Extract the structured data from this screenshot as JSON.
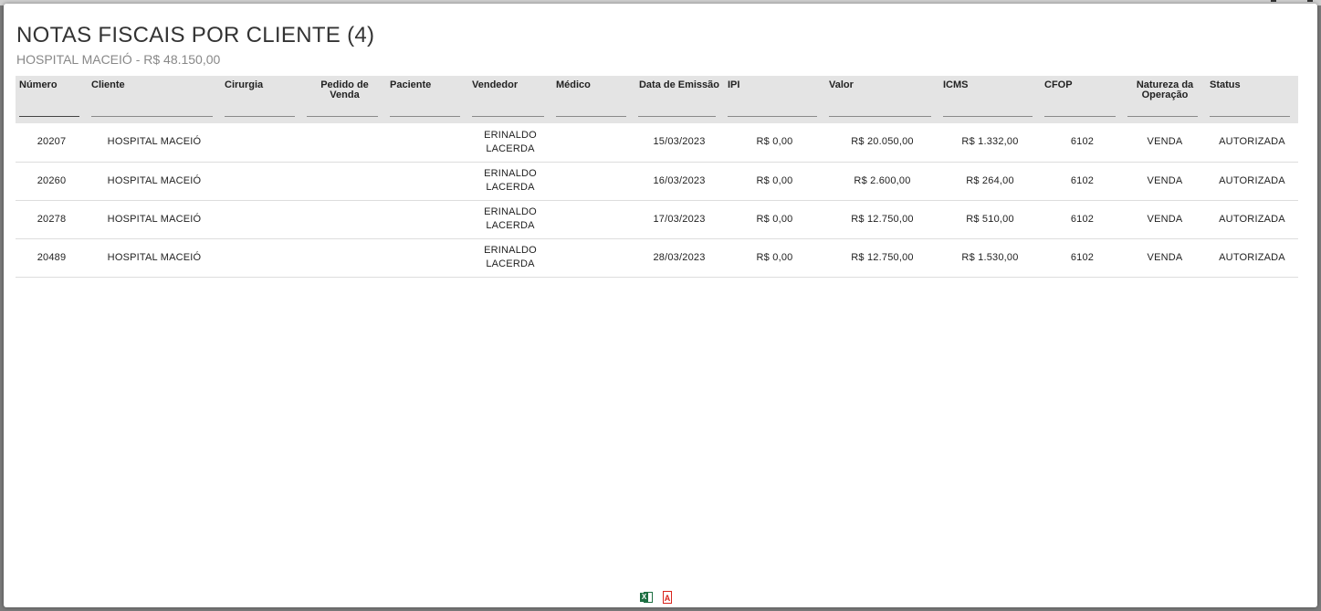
{
  "modal": {
    "title": "NOTAS FISCAIS POR CLIENTE (4)",
    "subtitle": "HOSPITAL MACEIÓ - R$ 48.150,00"
  },
  "table": {
    "columns": [
      {
        "key": "numero",
        "label": "Número"
      },
      {
        "key": "cliente",
        "label": "Cliente"
      },
      {
        "key": "cirurgia",
        "label": "Cirurgia"
      },
      {
        "key": "pedido",
        "label": "Pedido de Venda"
      },
      {
        "key": "paciente",
        "label": "Paciente"
      },
      {
        "key": "vendedor",
        "label": "Vendedor"
      },
      {
        "key": "medico",
        "label": "Médico"
      },
      {
        "key": "data",
        "label": "Data de Emissão"
      },
      {
        "key": "ipi",
        "label": "IPI"
      },
      {
        "key": "valor",
        "label": "Valor"
      },
      {
        "key": "icms",
        "label": "ICMS"
      },
      {
        "key": "cfop",
        "label": "CFOP"
      },
      {
        "key": "natureza",
        "label": "Natureza da Operação"
      },
      {
        "key": "status",
        "label": "Status"
      }
    ],
    "rows": [
      {
        "numero": "20207",
        "cliente": "HOSPITAL MACEIÓ",
        "cirurgia": "",
        "pedido": "",
        "paciente": "",
        "vendedor": "ERINALDO LACERDA",
        "medico": "",
        "data": "15/03/2023",
        "ipi": "R$ 0,00",
        "valor": "R$ 20.050,00",
        "icms": "R$ 1.332,00",
        "cfop": "6102",
        "natureza": "VENDA",
        "status": "AUTORIZADA"
      },
      {
        "numero": "20260",
        "cliente": "HOSPITAL MACEIÓ",
        "cirurgia": "",
        "pedido": "",
        "paciente": "",
        "vendedor": "ERINALDO LACERDA",
        "medico": "",
        "data": "16/03/2023",
        "ipi": "R$ 0,00",
        "valor": "R$ 2.600,00",
        "icms": "R$ 264,00",
        "cfop": "6102",
        "natureza": "VENDA",
        "status": "AUTORIZADA"
      },
      {
        "numero": "20278",
        "cliente": "HOSPITAL MACEIÓ",
        "cirurgia": "",
        "pedido": "",
        "paciente": "",
        "vendedor": "ERINALDO LACERDA",
        "medico": "",
        "data": "17/03/2023",
        "ipi": "R$ 0,00",
        "valor": "R$ 12.750,00",
        "icms": "R$ 510,00",
        "cfop": "6102",
        "natureza": "VENDA",
        "status": "AUTORIZADA"
      },
      {
        "numero": "20489",
        "cliente": "HOSPITAL MACEIÓ",
        "cirurgia": "",
        "pedido": "",
        "paciente": "",
        "vendedor": "ERINALDO LACERDA",
        "medico": "",
        "data": "28/03/2023",
        "ipi": "R$ 0,00",
        "valor": "R$ 12.750,00",
        "icms": "R$ 1.530,00",
        "cfop": "6102",
        "natureza": "VENDA",
        "status": "AUTORIZADA"
      }
    ]
  },
  "export": {
    "excel_icon": "excel-icon",
    "pdf_icon": "pdf-icon",
    "excel_color": "#1d6f42",
    "pdf_color": "#d9251d",
    "excel_glyph": "X",
    "pdf_glyph": "A"
  }
}
